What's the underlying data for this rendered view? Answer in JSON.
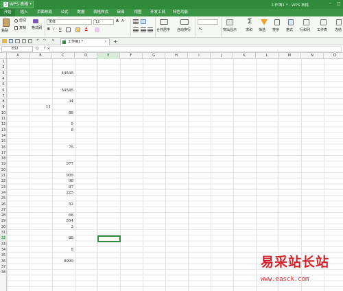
{
  "app": {
    "menu_button": "WPS 表格",
    "window_title": "工作簿1 * - WPS 表格"
  },
  "menus": [
    "开始",
    "插入",
    "页面布局",
    "公式",
    "数据",
    "表格样式",
    "审阅",
    "视图",
    "开发工具",
    "特色功能"
  ],
  "ribbon": {
    "paste": "粘贴",
    "cut": "剪切",
    "copy": "复制",
    "format_painter": "格式刷",
    "font_name": "宋体",
    "font_size": "12",
    "merge_center": "合并居中",
    "wrap_text": "自动换行",
    "number_format": "%",
    "show_hide": "突出显示",
    "sum": "求和",
    "filter": "筛选",
    "sort": "排序",
    "format": "格式",
    "rows_cols": "行和列",
    "worksheet": "工作表",
    "freeze": "冻结"
  },
  "doc_tab": "工作簿1 *",
  "name_box": "E32",
  "fx_label": "fx",
  "columns": [
    "A",
    "B",
    "C",
    "D",
    "E",
    "F",
    "G",
    "H",
    "I",
    "J",
    "K",
    "L",
    "M",
    "N",
    "O"
  ],
  "selected_column": "E",
  "rows": [
    "1",
    "2",
    "3",
    "4",
    "5",
    "6",
    "7",
    "8",
    "9",
    "10",
    "11",
    "12",
    "13",
    "14",
    "15",
    "16",
    "17",
    "18",
    "19",
    "20",
    "21",
    "22",
    "23",
    "24",
    "25",
    "26",
    "27",
    "28",
    "29",
    "30",
    "31",
    "32",
    "33",
    "34",
    "35",
    "36",
    "37",
    "38"
  ],
  "selected_row": "32",
  "cells": [
    {
      "row": 3,
      "col": "C",
      "value": "44545"
    },
    {
      "row": 6,
      "col": "C",
      "value": "54545"
    },
    {
      "row": 8,
      "col": "C",
      "value": "34"
    },
    {
      "row": 9,
      "col": "B",
      "value": "11"
    },
    {
      "row": 10,
      "col": "C",
      "value": "88"
    },
    {
      "row": 12,
      "col": "C",
      "value": "9"
    },
    {
      "row": 13,
      "col": "C",
      "value": "8"
    },
    {
      "row": 16,
      "col": "C",
      "value": "75"
    },
    {
      "row": 19,
      "col": "C",
      "value": "577"
    },
    {
      "row": 21,
      "col": "C",
      "value": "909"
    },
    {
      "row": 22,
      "col": "C",
      "value": "98"
    },
    {
      "row": 23,
      "col": "C",
      "value": "87"
    },
    {
      "row": 24,
      "col": "C",
      "value": "225"
    },
    {
      "row": 26,
      "col": "C",
      "value": "52"
    },
    {
      "row": 28,
      "col": "C",
      "value": "66"
    },
    {
      "row": 29,
      "col": "C",
      "value": "554"
    },
    {
      "row": 30,
      "col": "C",
      "value": "3"
    },
    {
      "row": 32,
      "col": "C",
      "value": "88"
    },
    {
      "row": 34,
      "col": "C",
      "value": "8"
    },
    {
      "row": 36,
      "col": "C",
      "value": "8999"
    }
  ],
  "watermark": {
    "title": "易采站长站",
    "url": "www.easck.com"
  },
  "colors": {
    "brand": "#2f8a3c",
    "selection": "#2f8a3c",
    "watermark": "#d2232a"
  }
}
